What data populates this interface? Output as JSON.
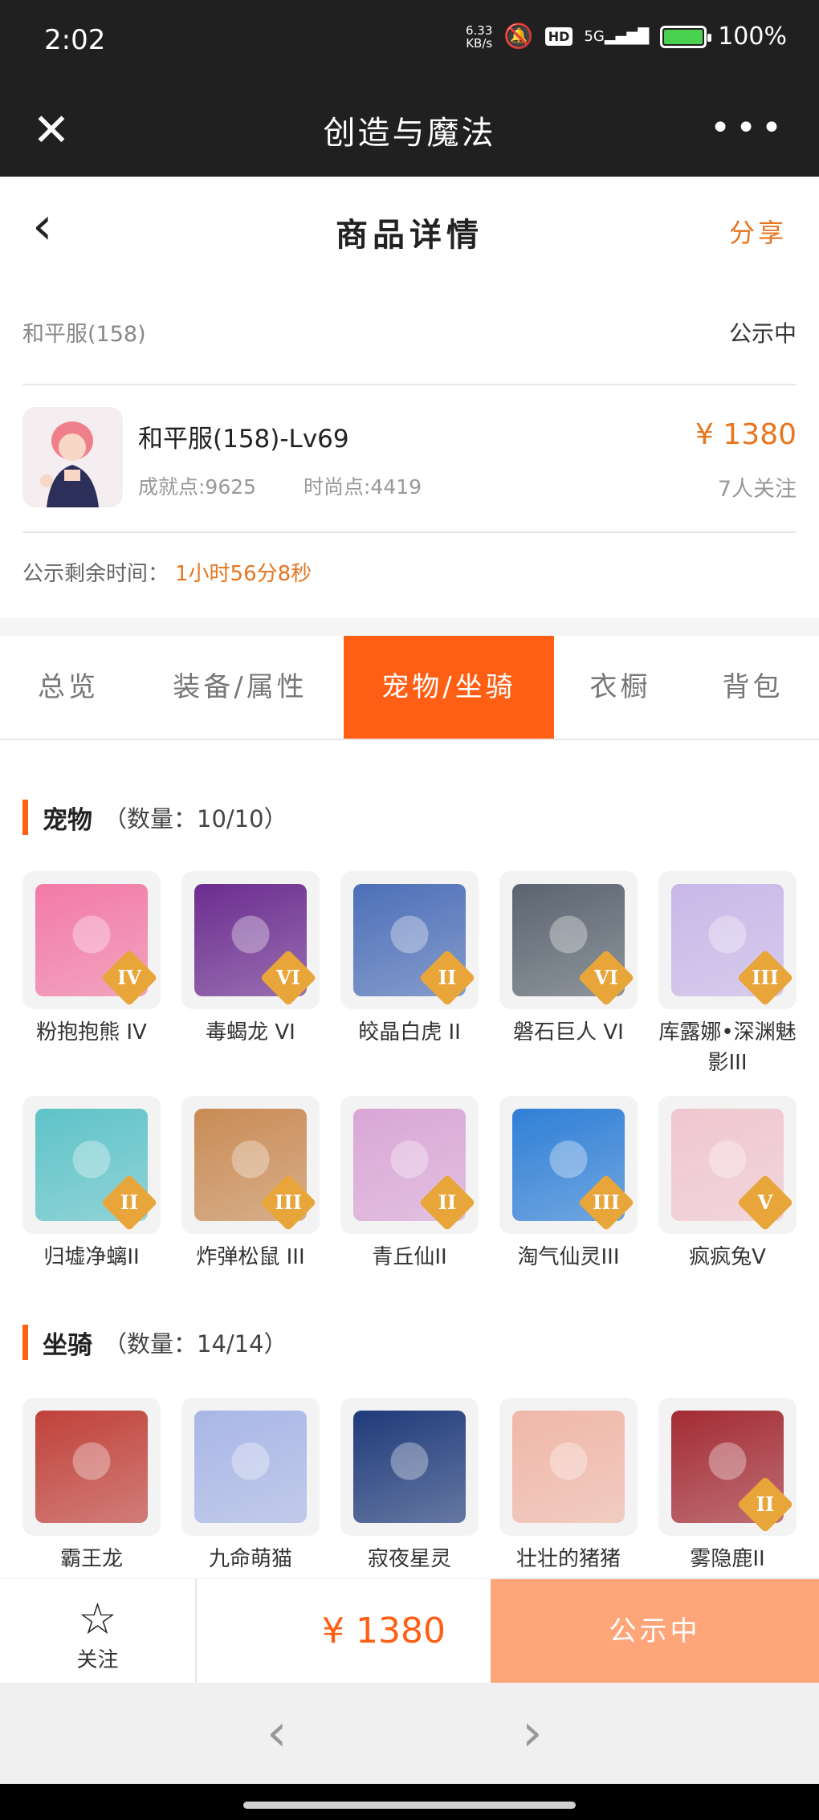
{
  "status_bar": {
    "time": "2:02",
    "net_speed_value": "6.33",
    "net_speed_unit": "KB/s",
    "hd": "HD",
    "signal": "5G",
    "battery": "100",
    "battery_level": 1.0
  },
  "top_bar": {
    "title": "创造与魔法",
    "close_icon": "close-icon",
    "more_icon": "more-icon"
  },
  "header": {
    "title": "商品详情",
    "share": "分享"
  },
  "listing": {
    "server": "和平服(158)",
    "status": "公示中",
    "name": "和平服(158)-Lv69",
    "achievement": "成就点:9625",
    "fashion": "时尚点:4419",
    "price": "¥ 1380",
    "followers": "7人关注",
    "countdown_label": "公示剩余时间：",
    "countdown_value": "1小时56分8秒"
  },
  "tabs": [
    {
      "label": "总览",
      "active": false
    },
    {
      "label": "装备/属性",
      "active": false
    },
    {
      "label": "宠物/坐骑",
      "active": true
    },
    {
      "label": "衣橱",
      "active": false
    },
    {
      "label": "背包",
      "active": false
    }
  ],
  "pets": {
    "title": "宠物",
    "count": "（数量：10/10）",
    "items": [
      {
        "name": "粉抱抱熊 IV",
        "tier": "IV",
        "color": "#f27aa6"
      },
      {
        "name": "毒蝎龙 VI",
        "tier": "VI",
        "color": "#6b2c8f"
      },
      {
        "name": "皎晶白虎 II",
        "tier": "II",
        "color": "#4d6fb8"
      },
      {
        "name": "磐石巨人 VI",
        "tier": "VI",
        "color": "#5a6470"
      },
      {
        "name": "库露娜•深渊魅影III",
        "tier": "III",
        "color": "#c8b7e8"
      },
      {
        "name": "归墟净螭II",
        "tier": "II",
        "color": "#5ec3c8"
      },
      {
        "name": "炸弹松鼠 III",
        "tier": "III",
        "color": "#c98b55"
      },
      {
        "name": "青丘仙II",
        "tier": "II",
        "color": "#d9a6d6"
      },
      {
        "name": "淘气仙灵III",
        "tier": "III",
        "color": "#2f7fd6"
      },
      {
        "name": "疯疯兔V",
        "tier": "V",
        "color": "#f0c6cf"
      }
    ]
  },
  "mounts": {
    "title": "坐骑",
    "count": "（数量：14/14）",
    "items": [
      {
        "name": "霸王龙",
        "tier": "",
        "color": "#c0413a"
      },
      {
        "name": "九命萌猫",
        "tier": "",
        "color": "#a9b6e6"
      },
      {
        "name": "寂夜星灵",
        "tier": "",
        "color": "#1f3a7a"
      },
      {
        "name": "壮壮的猪猪",
        "tier": "",
        "color": "#f0b7a8"
      },
      {
        "name": "雾隐鹿II",
        "tier": "II",
        "color": "#a32b34"
      }
    ]
  },
  "bottom_bar": {
    "follow": "关注",
    "price": "¥ 1380",
    "action": "公示中"
  }
}
